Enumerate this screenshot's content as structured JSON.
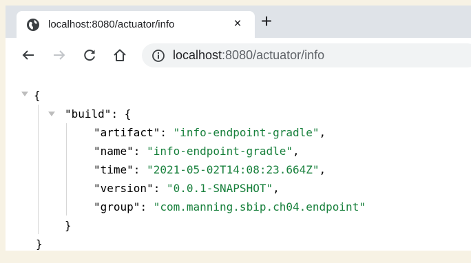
{
  "tab": {
    "title": "localhost:8080/actuator/info",
    "close_glyph": "×",
    "favicon": "globe-icon"
  },
  "new_tab_glyph": "+",
  "toolbar": {
    "back_icon": "back-arrow-icon",
    "forward_icon": "forward-arrow-icon",
    "reload_icon": "reload-icon",
    "home_icon": "home-icon",
    "info_icon": "info-icon"
  },
  "address": {
    "host": "localhost",
    "rest": ":8080/actuator/info"
  },
  "json": {
    "open_root": "{",
    "build_key": "\"build\"",
    "build_open": ": {",
    "close_build": "}",
    "close_root": "}",
    "entries": [
      {
        "key": "\"artifact\"",
        "value": "\"info-endpoint-gradle\"",
        "sep": ","
      },
      {
        "key": "\"name\"",
        "value": "\"info-endpoint-gradle\"",
        "sep": ","
      },
      {
        "key": "\"time\"",
        "value": "\"2021-05-02T14:08:23.664Z\"",
        "sep": ","
      },
      {
        "key": "\"version\"",
        "value": "\"0.0.1-SNAPSHOT\"",
        "sep": ","
      },
      {
        "key": "\"group\"",
        "value": "\"com.manning.sbip.ch04.endpoint\"",
        "sep": ""
      }
    ]
  },
  "colors": {
    "string": "#18803c",
    "tabstrip": "#dfe3e8",
    "page_border": "#f7f2e4"
  }
}
